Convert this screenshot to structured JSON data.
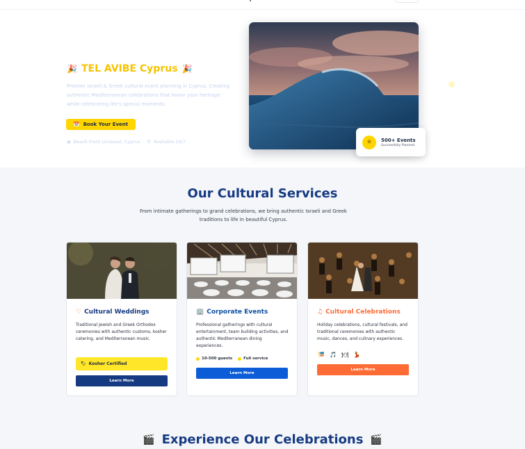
{
  "hero": {
    "title": "TEL AVIBE Cyprus",
    "title_icon": "party-popper-icon",
    "description": "Premier Israeli & Greek cultural event planning in Cyprus. Creating authentic Mediterranean celebrations that honor your heritage while celebrating life's special moments.",
    "book_label": "Book Your Event",
    "location": "Beach Front Limassol, Cyprus",
    "availability": "Available 24/7",
    "stat_value": "500+ Events",
    "stat_label": "Successfully Planned"
  },
  "services": {
    "title": "Our Cultural Services",
    "subtitle": "From intimate gatherings to grand celebrations, we bring authentic Israeli and Greek traditions to life in beautiful Cyprus.",
    "cards": [
      {
        "title": "Cultural Weddings",
        "icon": "heart-icon",
        "description": "Traditional Jewish and Greek Orthodox ceremonies with authentic customs, kosher catering, and Mediterranean music.",
        "badge": "Kosher Certified",
        "button": "Learn More"
      },
      {
        "title": "Corporate Events",
        "icon": "building-icon",
        "description": "Professional gatherings with cultural entertainment, team building activities, and authentic Mediterranean dining experiences.",
        "tag1": "10-500 guests",
        "tag2": "Full service",
        "button": "Learn More"
      },
      {
        "title": "Cultural Celebrations",
        "icon": "music-note-icon",
        "description": "Holiday celebrations, cultural festivals, and traditional ceremonies with authentic music, dances, and culinary experiences.",
        "button": "Learn More"
      }
    ]
  },
  "experience": {
    "title": "Experience Our Celebrations"
  },
  "colors": {
    "navy": "#163a82",
    "yellow": "#ffd500",
    "orange": "#ff6b35",
    "blue": "#0b5cd6"
  }
}
